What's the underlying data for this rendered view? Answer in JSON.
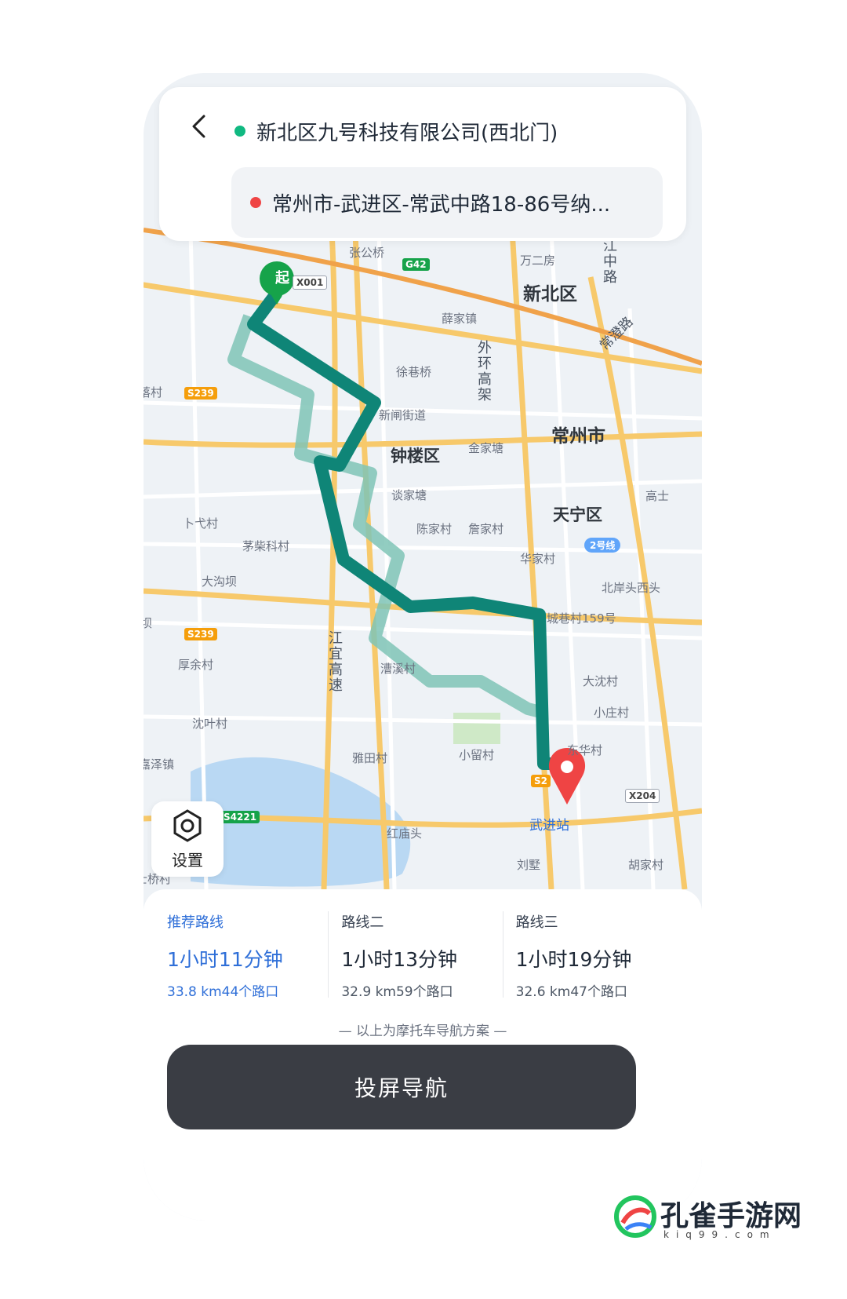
{
  "top": {
    "origin": "新北区九号科技有限公司(西北门)",
    "destination": "常州市-武进区-常武中路18-86号纳...",
    "origin_color": "#10b981",
    "destination_color": "#ef4444"
  },
  "map": {
    "start_marker": "起",
    "labels": {
      "zhang_gong_qiao": "张公桥",
      "wan_er_fang": "万二房",
      "xinbei_qu": "新北区",
      "xue_jia_zhen": "薛家镇",
      "xu_xiang_qiao": "徐巷桥",
      "luo_cun": "落村",
      "xin_zha_jie_dao": "新闸街道",
      "zhong_lou_qu": "钟楼区",
      "jin_jia_tang": "金家塘",
      "changzhou_shi": "常州市",
      "tan_jia_tang": "谈家塘",
      "gao_shi": "高士",
      "tianning_qu": "天宁区",
      "bu_dai_cun": "卜弋村",
      "chen_jia_cun": "陈家村",
      "zhan_jia_cun": "詹家村",
      "mao_chai_ke_cun": "茅柴科村",
      "hua_jia_cun": "华家村",
      "da_gou_ba": "大沟坝",
      "bei_an_tou": "北岸头西头",
      "ba": "坝",
      "cheng_xiang_cun": "城巷村159号",
      "hou_yu_cun": "厚余村",
      "cao_xi_cun": "漕溪村",
      "da_chen_cun": "大沈村",
      "shen_ye_cun": "沈叶村",
      "xiao_zhuang_cun": "小庄村",
      "dong_hua_cun": "东华村",
      "jia_ze_zhen": "嘉泽镇",
      "ya_tian_cun": "雅田村",
      "xiao_liu_cun": "小留村",
      "hong_miao_tou": "红庙头",
      "wujin_zhan": "武进站",
      "liu_shu": "刘墅",
      "hu_jia_cun": "胡家村",
      "shi_qiao_cun": "士桥村",
      "jiangzhong_lu": "江中路",
      "changzhou_lu": "常澄路",
      "waihuan": "外环高架",
      "jiangyi": "江宜高速",
      "line2": "2号线"
    },
    "shields": {
      "g42": "G42",
      "x001": "X001",
      "s239a": "S239",
      "s239b": "S239",
      "s4221": "S4221",
      "x204": "X204",
      "s2": "S2"
    },
    "colors": {
      "route_main": "#0f8577",
      "route_alt": "#7fc4b6",
      "water": "#b9d8f3",
      "road_major": "#f7c96b",
      "road_minor": "#ffffff"
    }
  },
  "settings": {
    "label": "设置",
    "icon": "hexagon-nut-icon"
  },
  "routes": [
    {
      "tag": "推荐路线",
      "time": "1小时11分钟",
      "meta": "33.8 km44个路口",
      "active": true
    },
    {
      "tag": "路线二",
      "time": "1小时13分钟",
      "meta": "32.9 km59个路口",
      "active": false
    },
    {
      "tag": "路线三",
      "time": "1小时19分钟",
      "meta": "32.6 km47个路口",
      "active": false
    }
  ],
  "note": "— 以上为摩托车导航方案 —",
  "nav_button": "投屏导航",
  "watermark": {
    "title": "孔雀手游网",
    "sub": "kiq99.com"
  }
}
